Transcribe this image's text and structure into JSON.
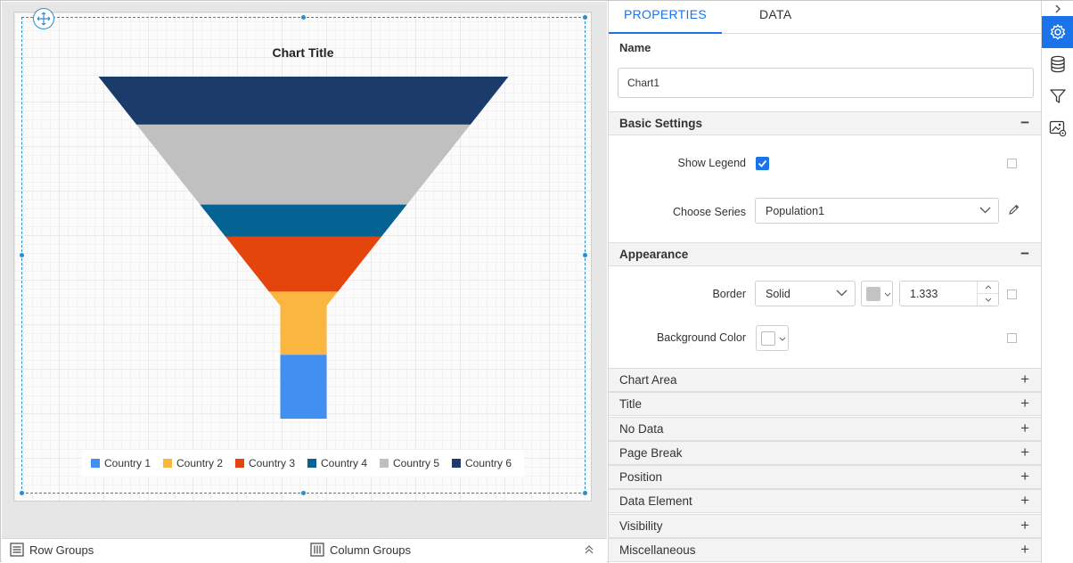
{
  "chart_data": {
    "type": "funnel",
    "title": "Chart Title",
    "series_name": "Population1",
    "categories": [
      "Country 6",
      "Country 5",
      "Country 4",
      "Country 3",
      "Country 2",
      "Country 1"
    ],
    "values": [
      54,
      90,
      36,
      62,
      71,
      72
    ],
    "colors": [
      "#1b3b6b",
      "#c0c0c0",
      "#046393",
      "#e3450d",
      "#fbb640",
      "#418ff0"
    ],
    "legend": [
      "Country 1",
      "Country 2",
      "Country 3",
      "Country 4",
      "Country 5",
      "Country 6"
    ],
    "legend_colors": [
      "#418ff0",
      "#fbb640",
      "#e3450d",
      "#046393",
      "#c0c0c0",
      "#1b3b6b"
    ],
    "legend_position": "bottom"
  },
  "bottom_bar": {
    "row_groups": "Row Groups",
    "column_groups": "Column Groups"
  },
  "panel": {
    "tabs": [
      "PROPERTIES",
      "DATA"
    ],
    "name_label": "Name",
    "name_value": "Chart1",
    "basic_settings": {
      "header": "Basic Settings",
      "toggle": "−",
      "show_legend_label": "Show Legend",
      "show_legend": true,
      "choose_series_label": "Choose Series",
      "choose_series_value": "Population1"
    },
    "appearance": {
      "header": "Appearance",
      "toggle": "−",
      "border_label": "Border",
      "border_style": "Solid",
      "border_color": "#c4c4c4",
      "border_width": "1.333",
      "background_color_label": "Background Color",
      "background_color": "#ffffff"
    },
    "collapsed_sections": [
      {
        "label": "Chart Area",
        "toggle": "+"
      },
      {
        "label": "Title",
        "toggle": "+"
      },
      {
        "label": "No Data",
        "toggle": "+"
      },
      {
        "label": "Page Break",
        "toggle": "+"
      },
      {
        "label": "Position",
        "toggle": "+"
      },
      {
        "label": "Data Element",
        "toggle": "+"
      },
      {
        "label": "Visibility",
        "toggle": "+"
      },
      {
        "label": "Miscellaneous",
        "toggle": "+"
      }
    ]
  },
  "strip": {
    "icons": [
      "chevron-right-icon",
      "settings-icon",
      "database-icon",
      "filter-icon",
      "image-settings-icon"
    ],
    "accent": "#1a73e8"
  }
}
